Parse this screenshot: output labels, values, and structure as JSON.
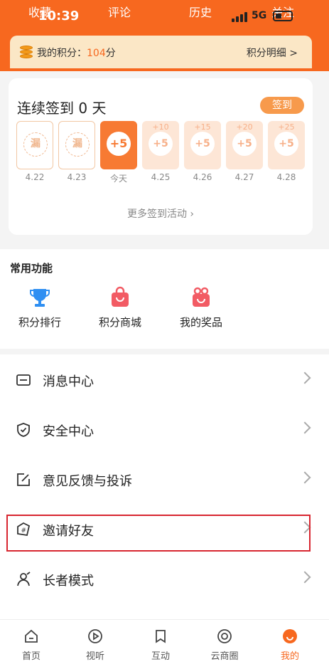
{
  "top_tabs": [
    "收藏",
    "评论",
    "历史",
    "关注"
  ],
  "status_bar": {
    "time": "10:39",
    "network": "5G"
  },
  "points": {
    "label": "我的积分：",
    "value": "104",
    "unit": "分",
    "detail_label": "积分明细 >"
  },
  "checkin": {
    "title": "连续签到 0 天",
    "button_label": "签到",
    "days": [
      {
        "bonus": "",
        "mark": "漏",
        "date": "4.22",
        "state": "past"
      },
      {
        "bonus": "",
        "mark": "漏",
        "date": "4.23",
        "state": "past"
      },
      {
        "bonus": "",
        "mark": "+5",
        "date": "今天",
        "state": "today"
      },
      {
        "bonus": "+10",
        "mark": "+5",
        "date": "4.25",
        "state": "future"
      },
      {
        "bonus": "+15",
        "mark": "+5",
        "date": "4.26",
        "state": "future"
      },
      {
        "bonus": "+20",
        "mark": "+5",
        "date": "4.27",
        "state": "future"
      },
      {
        "bonus": "+25",
        "mark": "+5",
        "date": "4.28",
        "state": "future"
      }
    ],
    "more_label": "更多签到活动 ›"
  },
  "functions": {
    "title": "常用功能",
    "items": [
      {
        "label": "积分排行",
        "icon": "trophy-icon"
      },
      {
        "label": "积分商城",
        "icon": "shopping-bag-icon"
      },
      {
        "label": "我的奖品",
        "icon": "gift-icon"
      }
    ]
  },
  "menu": [
    {
      "label": "消息中心",
      "icon": "message-icon"
    },
    {
      "label": "安全中心",
      "icon": "shield-icon"
    },
    {
      "label": "意见反馈与投诉",
      "icon": "edit-icon"
    },
    {
      "label": "邀请好友",
      "icon": "invite-icon"
    },
    {
      "label": "长者模式",
      "icon": "elder-icon"
    }
  ],
  "bottom_nav": [
    {
      "label": "首页",
      "icon": "home-icon"
    },
    {
      "label": "视听",
      "icon": "play-icon"
    },
    {
      "label": "互动",
      "icon": "bookmark-icon"
    },
    {
      "label": "云商圈",
      "icon": "circle-icon"
    },
    {
      "label": "我的",
      "icon": "profile-icon",
      "active": true
    }
  ],
  "colors": {
    "brand": "#f7681f",
    "highlight_box": "#d82630"
  }
}
